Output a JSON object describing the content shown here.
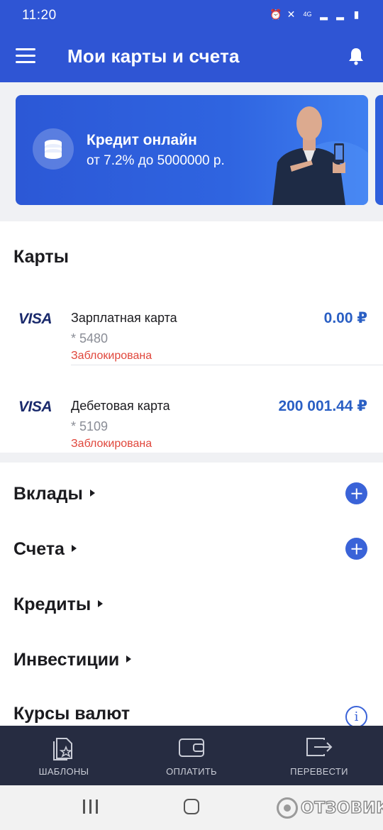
{
  "status_bar": {
    "time": "11:20"
  },
  "header": {
    "title": "Мои карты и счета"
  },
  "promo": {
    "title": "Кредит онлайн",
    "subtitle": "от 7.2% до 5000000 р."
  },
  "cards_section": {
    "title": "Карты",
    "items": [
      {
        "brand": "VISA",
        "name": "Зарплатная карта",
        "number": "* 5480",
        "status": "Заблокирована",
        "balance": "0.00 ₽"
      },
      {
        "brand": "VISA",
        "name": "Дебетовая карта",
        "number": "* 5109",
        "status": "Заблокирована",
        "balance": "200 001.44 ₽"
      }
    ]
  },
  "products": [
    {
      "label": "Вклады",
      "action": "plus"
    },
    {
      "label": "Счета",
      "action": "plus"
    },
    {
      "label": "Кредиты",
      "action": "none"
    },
    {
      "label": "Инвестиции",
      "action": "none"
    },
    {
      "label": "Курсы валют",
      "action": "info"
    }
  ],
  "bottom_nav": [
    {
      "label": "ШАБЛОНЫ",
      "icon": "template-star-icon"
    },
    {
      "label": "ОПЛАТИТЬ",
      "icon": "wallet-icon"
    },
    {
      "label": "ПЕРЕВЕСТИ",
      "icon": "transfer-arrow-icon"
    }
  ],
  "watermark": {
    "text": "ОТЗОВИК"
  },
  "colors": {
    "primary": "#2f55d4",
    "balance": "#2a5fc4",
    "blocked": "#e0463b",
    "nav_bg": "#262c41"
  }
}
